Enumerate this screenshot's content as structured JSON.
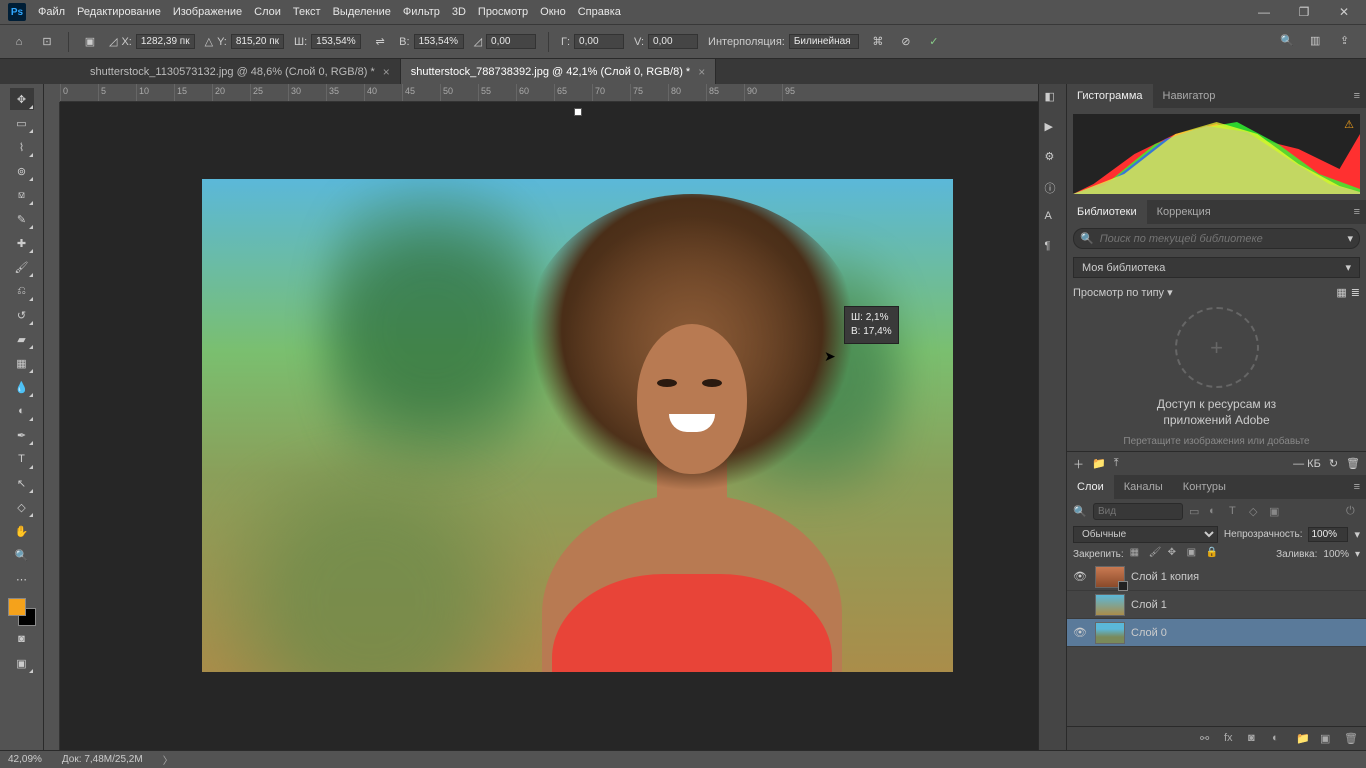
{
  "menu": {
    "items": [
      "Файл",
      "Редактирование",
      "Изображение",
      "Слои",
      "Текст",
      "Выделение",
      "Фильтр",
      "3D",
      "Просмотр",
      "Окно",
      "Справка"
    ]
  },
  "options": {
    "x_label": "X:",
    "x_val": "1282,39 пк",
    "y_label": "Y:",
    "y_val": "815,20 пк",
    "w_label": "Ш:",
    "w_val": "153,54%",
    "h_label": "В:",
    "h_val": "153,54%",
    "angle_val": "0,00",
    "hskew_label": "Г:",
    "hskew_val": "0,00",
    "vskew_label": "V:",
    "vskew_val": "0,00",
    "interp_label": "Интерполяция:",
    "interp_val": "Билинейная"
  },
  "tabs": [
    {
      "title": "shutterstock_1130573132.jpg @ 48,6% (Слой 0, RGB/8) *",
      "active": false
    },
    {
      "title": "shutterstock_788738392.jpg @ 42,1% (Слой 0, RGB/8) *",
      "active": true
    }
  ],
  "ruler_ticks": [
    "0",
    "5",
    "10",
    "15",
    "20",
    "25",
    "30",
    "35",
    "40",
    "45",
    "50",
    "55",
    "60",
    "65",
    "70",
    "75",
    "80",
    "85",
    "90",
    "95"
  ],
  "tooltip": {
    "line1": "Ш: 2,1%",
    "line2": "В: 17,4%"
  },
  "panels": {
    "histogram": {
      "tabs": [
        "Гистограмма",
        "Навигатор"
      ],
      "active": 0
    },
    "library": {
      "tabs": [
        "Библиотеки",
        "Коррекция"
      ],
      "active": 0,
      "search_placeholder": "Поиск по текущей библиотеке",
      "dropdown": "Моя библиотека",
      "view_label": "Просмотр по типу",
      "drop_title": "Доступ к ресурсам из\nприложений Adobe",
      "drop_subtitle": "Перетащите изображения или добавьте",
      "kb_label": "— КБ"
    },
    "layers": {
      "tabs": [
        "Слои",
        "Каналы",
        "Контуры"
      ],
      "active": 0,
      "filter_placeholder": "Вид",
      "blend_mode": "Обычные",
      "opacity_label": "Непрозрачность:",
      "opacity_val": "100%",
      "lock_label": "Закрепить:",
      "fill_label": "Заливка:",
      "fill_val": "100%",
      "items": [
        {
          "name": "Слой 1 копия",
          "visible": true,
          "thumb": "t1",
          "masked": true,
          "selected": false
        },
        {
          "name": "Слой 1",
          "visible": false,
          "thumb": "t2",
          "masked": false,
          "selected": false
        },
        {
          "name": "Слой 0",
          "visible": true,
          "thumb": "t0",
          "masked": false,
          "selected": true
        }
      ]
    }
  },
  "status": {
    "zoom": "42,09%",
    "doc_label": "Док:",
    "doc_val": "7,48M/25,2M"
  }
}
